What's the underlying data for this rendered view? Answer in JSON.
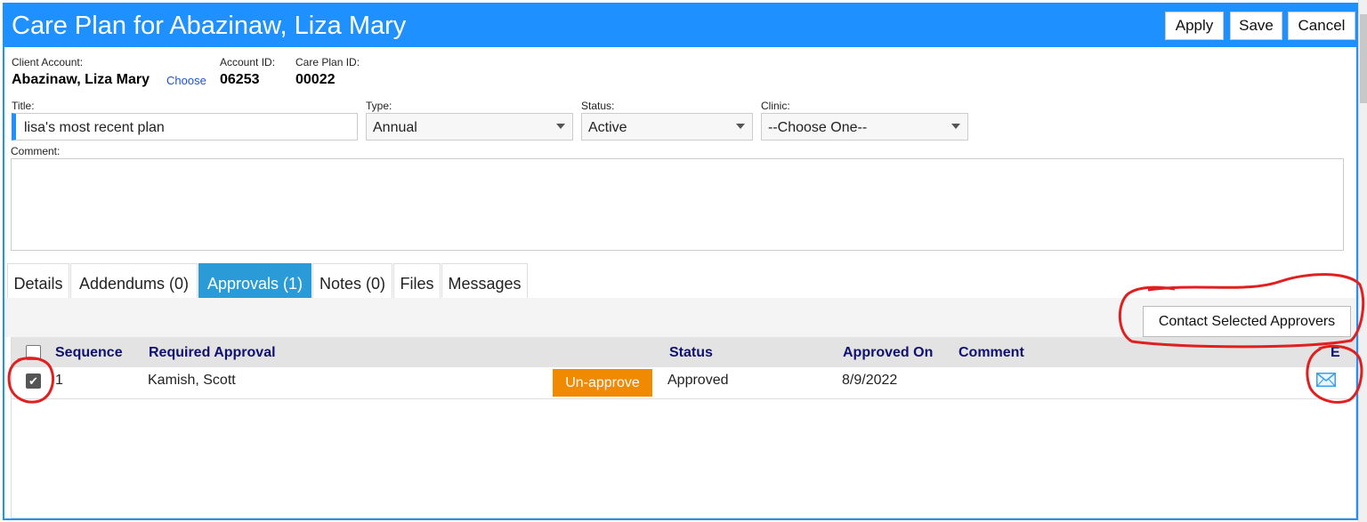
{
  "window": {
    "title": "Care Plan for Abazinaw, Liza Mary"
  },
  "toolbar": {
    "apply_label": "Apply",
    "save_label": "Save",
    "cancel_label": "Cancel"
  },
  "header": {
    "client_account_label": "Client Account:",
    "client_name": "Abazinaw, Liza Mary",
    "choose_label": "Choose",
    "account_id_label": "Account ID:",
    "account_id": "06253",
    "care_plan_id_label": "Care Plan ID:",
    "care_plan_id": "00022"
  },
  "form": {
    "title_label": "Title:",
    "title_value": "lisa's most recent plan",
    "type_label": "Type:",
    "type_value": "Annual",
    "status_label": "Status:",
    "status_value": "Active",
    "clinic_label": "Clinic:",
    "clinic_value": "--Choose One--",
    "comment_label": "Comment:"
  },
  "tabs": [
    {
      "label": "Details",
      "active": false
    },
    {
      "label": "Addendums (0)",
      "active": false
    },
    {
      "label": "Approvals (1)",
      "active": true
    },
    {
      "label": "Notes (0)",
      "active": false
    },
    {
      "label": "Files",
      "active": false
    },
    {
      "label": "Messages",
      "active": false
    }
  ],
  "approvals": {
    "contact_button_label": "Contact Selected Approvers",
    "columns": {
      "sequence": "Sequence",
      "required_approval": "Required Approval",
      "status": "Status",
      "approved_on": "Approved On",
      "comment": "Comment",
      "email": "E"
    },
    "rows": [
      {
        "selected": true,
        "sequence": "1",
        "required_approval": "Kamish, Scott",
        "action_label": "Un-approve",
        "status": "Approved",
        "approved_on": "8/9/2022",
        "comment": ""
      }
    ]
  },
  "icons": {
    "email": "envelope-icon",
    "dropdown": "chevron-down-icon",
    "checkbox": "checkmark-icon"
  },
  "colors": {
    "header_blue": "#1e90ff",
    "active_tab": "#2b9bd8",
    "unapprove_orange": "#f08a00",
    "annotation_red": "#e02020"
  }
}
